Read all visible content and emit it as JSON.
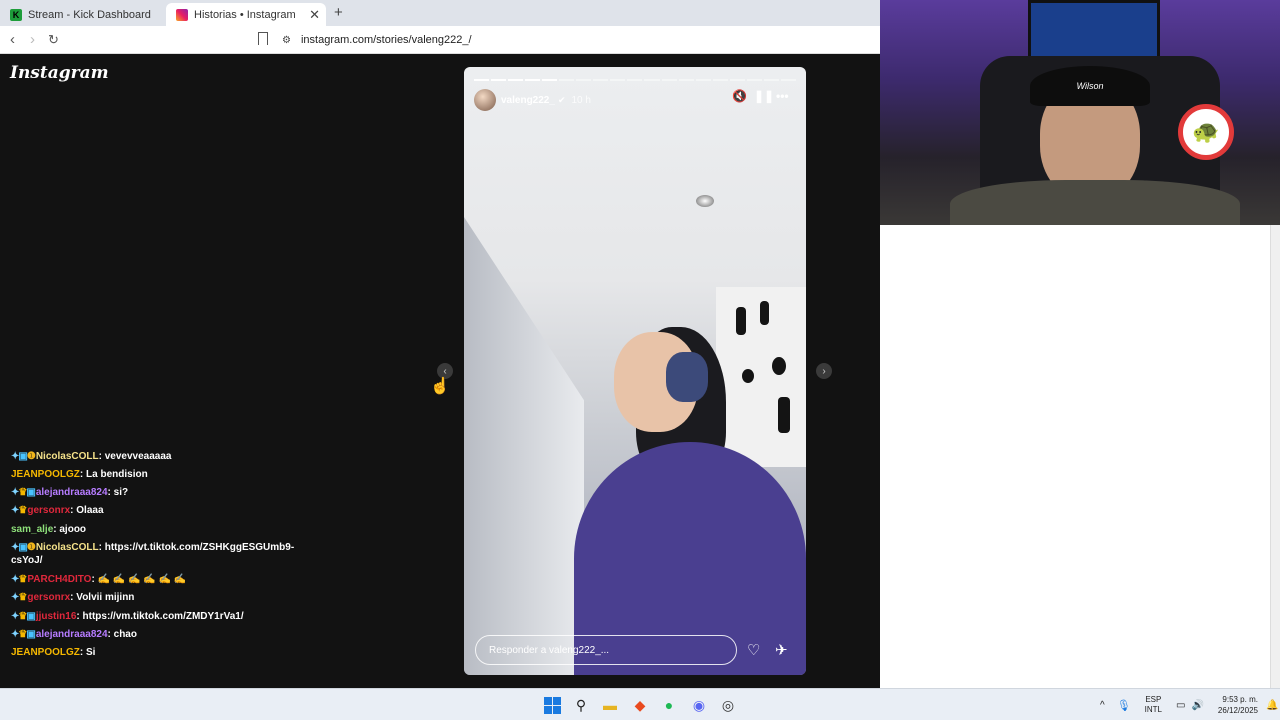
{
  "browser": {
    "tabs": [
      {
        "title": "Stream - Kick Dashboard",
        "favicon": "kick-icon",
        "active": false
      },
      {
        "title": "Historias • Instagram",
        "favicon": "instagram-icon",
        "active": true
      }
    ],
    "url": "instagram.com/stories/valeng222_/",
    "new_tab_glyph": "+"
  },
  "instagram": {
    "logo_text": "Instagram",
    "story": {
      "username": "valeng222_",
      "time": "10 h",
      "progress_total": 19,
      "progress_done": 5,
      "reply_placeholder": "Responder a valeng222_..."
    }
  },
  "chat": {
    "messages": [
      {
        "badges": [
          "sword",
          "sub",
          "warn"
        ],
        "user": "NicolasCOLL",
        "user_color": "#f5e28a",
        "text": "vevevveaaaaa"
      },
      {
        "badges": [],
        "user": "JEANPOOLGZ",
        "user_color": "#f5b800",
        "text": "La bendision"
      },
      {
        "badges": [
          "sword",
          "crown",
          "sub"
        ],
        "user": "alejandraaa824",
        "user_color": "#b67cff",
        "text": "si?"
      },
      {
        "badges": [
          "sword",
          "crown"
        ],
        "user": "gersonrx",
        "user_color": "#e0283c",
        "text": "Olaaa"
      },
      {
        "badges": [],
        "user": "sam_alje",
        "user_color": "#8ee07a",
        "text": "ajooo"
      },
      {
        "badges": [
          "sword",
          "sub",
          "warn"
        ],
        "user": "NicolasCOLL",
        "user_color": "#f5e28a",
        "text": "https://vt.tiktok.com/ZSHKggESGUmb9-csYoJ/"
      },
      {
        "badges": [
          "sword",
          "crown"
        ],
        "user": "PARCH4DITO",
        "user_color": "#e0283c",
        "text": "✍ ✍ ✍ ✍ ✍ ✍"
      },
      {
        "badges": [
          "sword",
          "crown"
        ],
        "user": "gersonrx",
        "user_color": "#e0283c",
        "text": "Volvii mijinn"
      },
      {
        "badges": [
          "sword",
          "crown",
          "sub"
        ],
        "user": "jjustin16",
        "user_color": "#e0283c",
        "text": "https://vm.tiktok.com/ZMDY1rVa1/"
      },
      {
        "badges": [
          "sword",
          "crown",
          "sub"
        ],
        "user": "alejandraaa824",
        "user_color": "#b67cff",
        "text": "chao"
      },
      {
        "badges": [],
        "user": "JEANPOOLGZ",
        "user_color": "#f5b800",
        "text": "Si"
      }
    ]
  },
  "webcam": {
    "cap_text": "Wilson"
  },
  "taskbar": {
    "language": "ESP",
    "layout": "INTL",
    "time": "9:53 p. m.",
    "date": "26/12/2025"
  },
  "colors": {
    "ig_background": "#121212",
    "taskbar": "#e9eef5",
    "accent_blue": "#1a7ae0"
  }
}
